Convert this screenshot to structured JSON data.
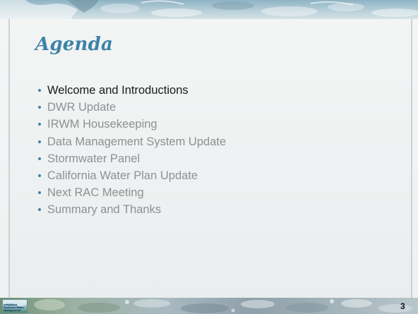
{
  "slide": {
    "title": "Agenda",
    "agenda_items": [
      "Welcome and Introductions",
      "DWR Update",
      "IRWM Housekeeping",
      "Data Management System Update",
      "Stormwater Panel",
      "California Water Plan Update",
      "Next RAC Meeting",
      "Summary and Thanks"
    ],
    "active_item_index": 0,
    "page_number": "3"
  },
  "logo": {
    "text": "Integrated Regional Water Management"
  },
  "colors": {
    "title": "#3d83a8",
    "bullet": "#3d83a8",
    "active_text": "#1a1a1a",
    "inactive_text": "#8e9091"
  }
}
